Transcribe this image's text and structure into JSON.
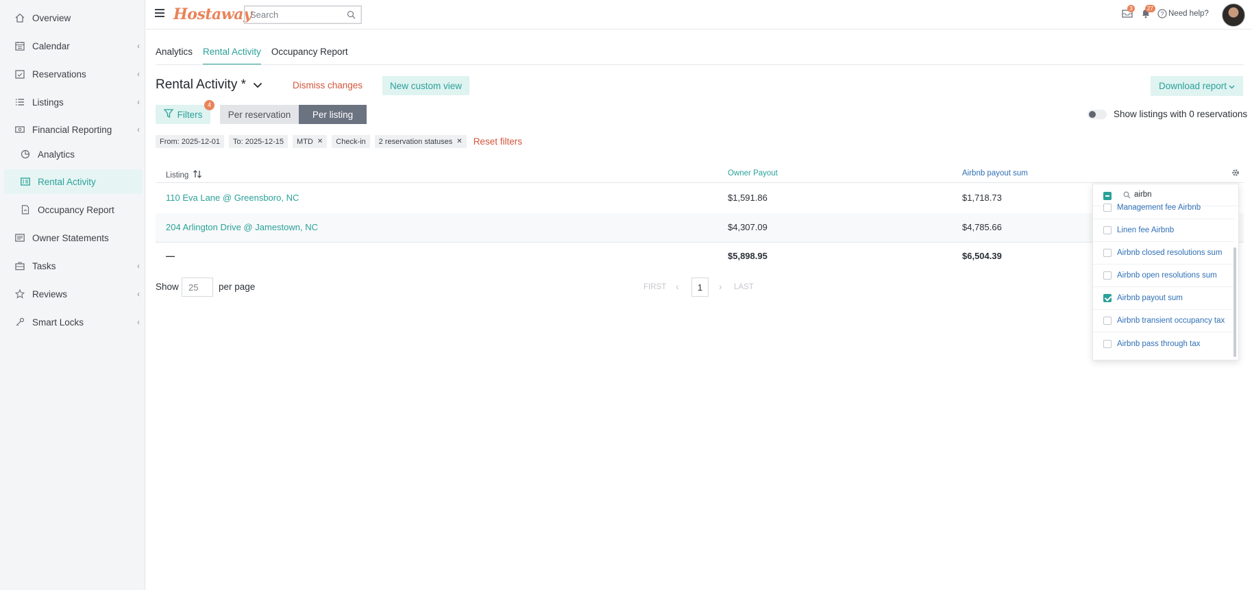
{
  "sidebar": {
    "items": [
      {
        "label": "Overview",
        "icon": "home-icon",
        "chevron": false
      },
      {
        "label": "Calendar",
        "icon": "calendar-icon",
        "chevron": true
      },
      {
        "label": "Reservations",
        "icon": "reservation-icon",
        "chevron": true
      },
      {
        "label": "Listings",
        "icon": "list-icon",
        "chevron": true
      },
      {
        "label": "Financial Reporting",
        "icon": "money-icon",
        "chevron": true
      },
      {
        "label": "Analytics",
        "icon": "pie-chart-icon",
        "chevron": false
      },
      {
        "label": "Rental Activity",
        "icon": "report-icon",
        "chevron": false,
        "active": true
      },
      {
        "label": "Occupancy Report",
        "icon": "document-icon",
        "chevron": false
      },
      {
        "label": "Owner Statements",
        "icon": "statement-icon",
        "chevron": false
      },
      {
        "label": "Tasks",
        "icon": "briefcase-icon",
        "chevron": true
      },
      {
        "label": "Reviews",
        "icon": "star-icon",
        "chevron": true
      },
      {
        "label": "Smart Locks",
        "icon": "key-icon",
        "chevron": true
      }
    ]
  },
  "topbar": {
    "logo": "Hostaway",
    "search_placeholder": "Search",
    "inbox_count": "3",
    "notifications_count": "27",
    "help_label": "Need help?"
  },
  "tabs": [
    "Analytics",
    "Rental Activity",
    "Occupancy Report"
  ],
  "view": {
    "title": "Rental Activity *",
    "dismiss_label": "Dismiss changes",
    "new_view_label": "New custom view",
    "download_label": "Download report"
  },
  "filters": {
    "button_label": "Filters",
    "count": "4",
    "seg_per_reservation": "Per reservation",
    "seg_per_listing": "Per listing",
    "toggle_label": "Show listings with 0 reservations",
    "chips": [
      {
        "label": "From: 2025-12-01",
        "removable": false
      },
      {
        "label": "To: 2025-12-15",
        "removable": false
      },
      {
        "label": "MTD",
        "removable": true
      },
      {
        "label": "Check-in",
        "removable": false
      },
      {
        "label": "2 reservation statuses",
        "removable": true
      }
    ],
    "reset_label": "Reset filters"
  },
  "table": {
    "headers": {
      "listing": "Listing",
      "owner_payout": "Owner Payout",
      "airbnb_payout_sum": "Airbnb payout sum"
    },
    "rows": [
      {
        "listing": "110 Eva Lane @ Greensboro, NC",
        "owner_payout": "$1,591.86",
        "airbnb_payout_sum": "$1,718.73"
      },
      {
        "listing": "204 Arlington Drive @ Jamestown, NC",
        "owner_payout": "$4,307.09",
        "airbnb_payout_sum": "$4,785.66"
      }
    ],
    "total": {
      "listing": "—",
      "owner_payout": "$5,898.95",
      "airbnb_payout_sum": "$6,504.39"
    }
  },
  "pagination": {
    "show_label": "Show",
    "per_page_value": "25",
    "per_page_label": "per page",
    "first": "FIRST",
    "last": "LAST",
    "current_page": "1"
  },
  "column_picker": {
    "query": "airbn",
    "items": [
      {
        "label": "Management fee Airbnb",
        "checked": false
      },
      {
        "label": "Linen fee Airbnb",
        "checked": false
      },
      {
        "label": "Airbnb closed resolutions sum",
        "checked": false
      },
      {
        "label": "Airbnb open resolutions sum",
        "checked": false
      },
      {
        "label": "Airbnb payout sum",
        "checked": true
      },
      {
        "label": "Airbnb transient occupancy tax",
        "checked": false
      },
      {
        "label": "Airbnb pass through tax",
        "checked": false
      }
    ]
  },
  "colors": {
    "accent": "#2aa198",
    "danger": "#d2553b",
    "brand": "#e9835a",
    "link_blue": "#2f6fb5"
  }
}
